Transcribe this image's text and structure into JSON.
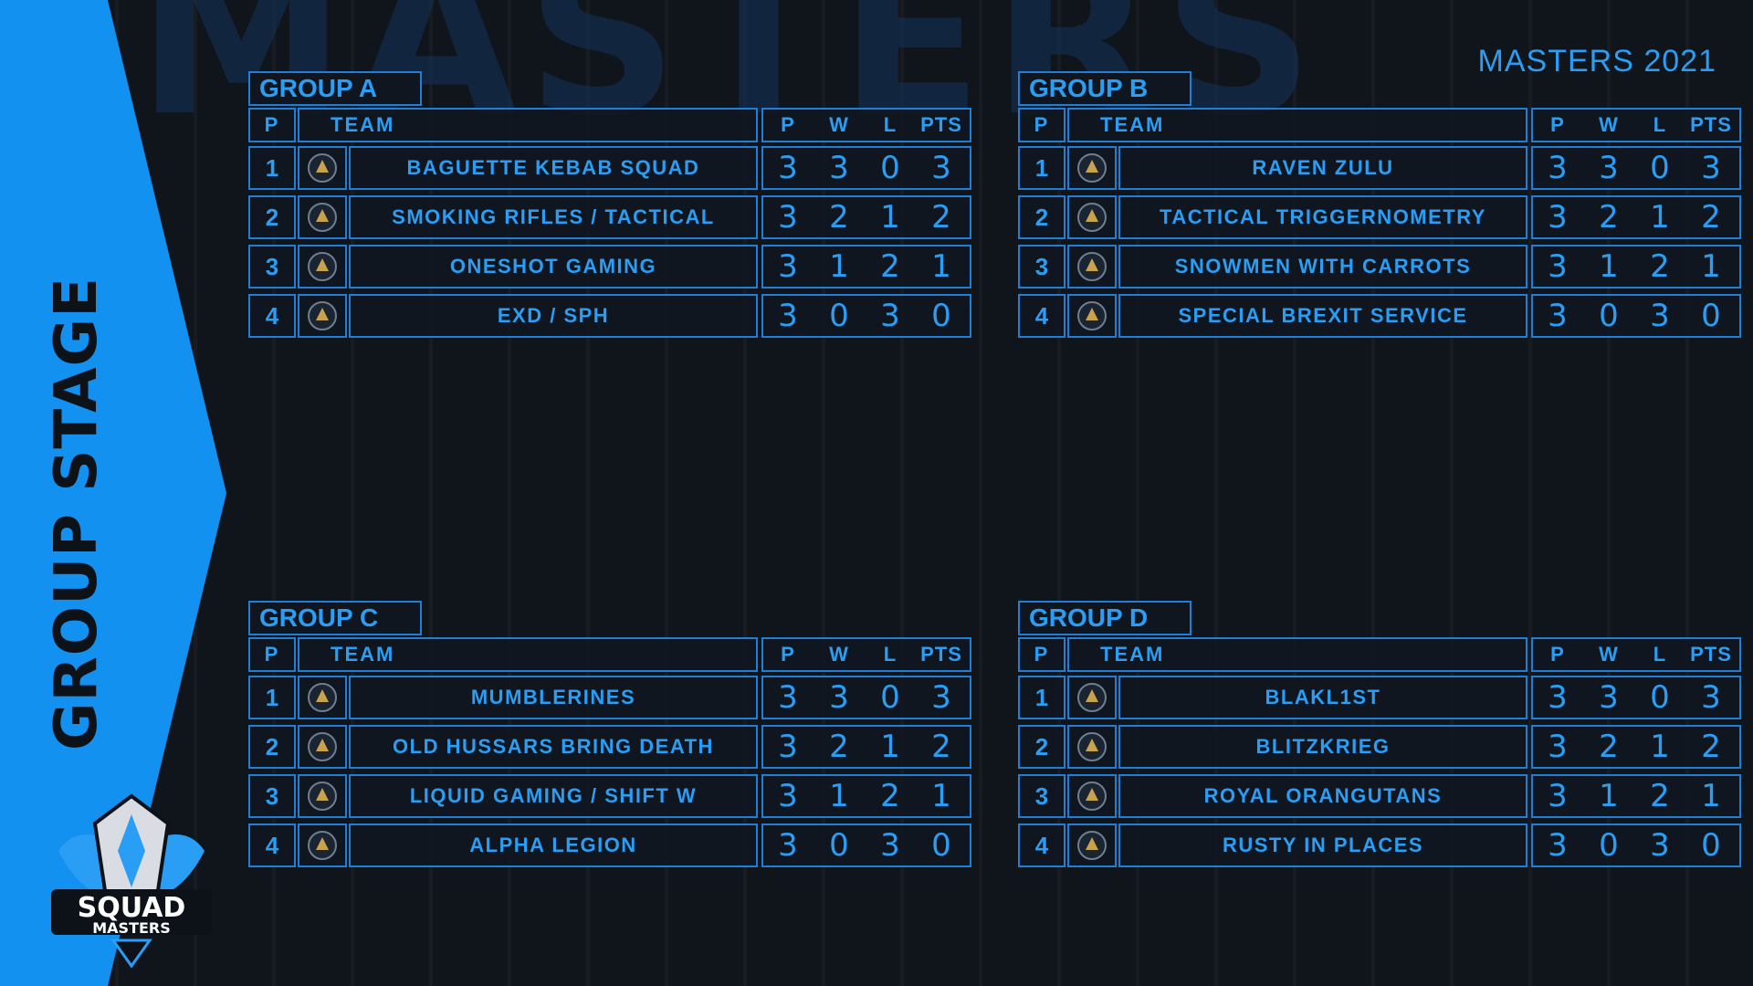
{
  "header": {
    "background_word": "MASTERS",
    "event_title": "MASTERS 2021",
    "stage_title": "GROUP STAGE",
    "brand_line1": "SQUAD",
    "brand_line2": "MASTERS"
  },
  "table_headers": {
    "position": "P",
    "team": "TEAM",
    "played": "P",
    "won": "W",
    "lost": "L",
    "points": "PTS"
  },
  "colors": {
    "accent": "#2a9df4",
    "border": "#1f7fd6",
    "band": "#1391f0",
    "background": "#10141b"
  },
  "groups": [
    {
      "name": "GROUP A",
      "rows": [
        {
          "pos": "1",
          "team": "BAGUETTE KEBAB SQUAD",
          "logo": "baguette-kebab-logo-icon",
          "p": "3",
          "w": "3",
          "l": "0",
          "pts": "3"
        },
        {
          "pos": "2",
          "team": "SMOKING RIFLES / TACTICAL",
          "logo": "smoking-rifles-logo-icon",
          "p": "3",
          "w": "2",
          "l": "1",
          "pts": "2"
        },
        {
          "pos": "3",
          "team": "ONESHOT GAMING",
          "logo": "oneshot-logo-icon",
          "p": "3",
          "w": "1",
          "l": "2",
          "pts": "1"
        },
        {
          "pos": "4",
          "team": "EXD / SPH",
          "logo": "exd-sph-logo-icon",
          "p": "3",
          "w": "0",
          "l": "3",
          "pts": "0"
        }
      ]
    },
    {
      "name": "GROUP B",
      "rows": [
        {
          "pos": "1",
          "team": "RAVEN ZULU",
          "logo": "raven-zulu-logo-icon",
          "p": "3",
          "w": "3",
          "l": "0",
          "pts": "3"
        },
        {
          "pos": "2",
          "team": "TACTICAL TRIGGERNOMETRY",
          "logo": "tactical-triggernometry-logo-icon",
          "p": "3",
          "w": "2",
          "l": "1",
          "pts": "2"
        },
        {
          "pos": "3",
          "team": "SNOWMEN WITH CARROTS",
          "logo": "snowmen-logo-icon",
          "p": "3",
          "w": "1",
          "l": "2",
          "pts": "1"
        },
        {
          "pos": "4",
          "team": "SPECIAL BREXIT SERVICE",
          "logo": "special-brexit-logo-icon",
          "p": "3",
          "w": "0",
          "l": "3",
          "pts": "0"
        }
      ]
    },
    {
      "name": "GROUP C",
      "rows": [
        {
          "pos": "1",
          "team": "MUMBLERINES",
          "logo": "mumblerines-logo-icon",
          "p": "3",
          "w": "3",
          "l": "0",
          "pts": "3"
        },
        {
          "pos": "2",
          "team": "OLD HUSSARS BRING DEATH",
          "logo": "old-hussars-logo-icon",
          "p": "3",
          "w": "2",
          "l": "1",
          "pts": "2"
        },
        {
          "pos": "3",
          "team": "LIQUID GAMING / SHIFT W",
          "logo": "liquid-gaming-logo-icon",
          "p": "3",
          "w": "1",
          "l": "2",
          "pts": "1"
        },
        {
          "pos": "4",
          "team": "ALPHA LEGION",
          "logo": "alpha-legion-logo-icon",
          "p": "3",
          "w": "0",
          "l": "3",
          "pts": "0"
        }
      ]
    },
    {
      "name": "GROUP D",
      "rows": [
        {
          "pos": "1",
          "team": "BLAKL1ST",
          "logo": "blakl1st-logo-icon",
          "p": "3",
          "w": "3",
          "l": "0",
          "pts": "3"
        },
        {
          "pos": "2",
          "team": "BLITZKRIEG",
          "logo": "blitzkrieg-logo-icon",
          "p": "3",
          "w": "2",
          "l": "1",
          "pts": "2"
        },
        {
          "pos": "3",
          "team": "ROYAL ORANGUTANS",
          "logo": "royal-orangutans-logo-icon",
          "p": "3",
          "w": "1",
          "l": "2",
          "pts": "1"
        },
        {
          "pos": "4",
          "team": "RUSTY IN PLACES",
          "logo": "rusty-in-places-logo-icon",
          "p": "3",
          "w": "0",
          "l": "3",
          "pts": "0"
        }
      ]
    }
  ]
}
